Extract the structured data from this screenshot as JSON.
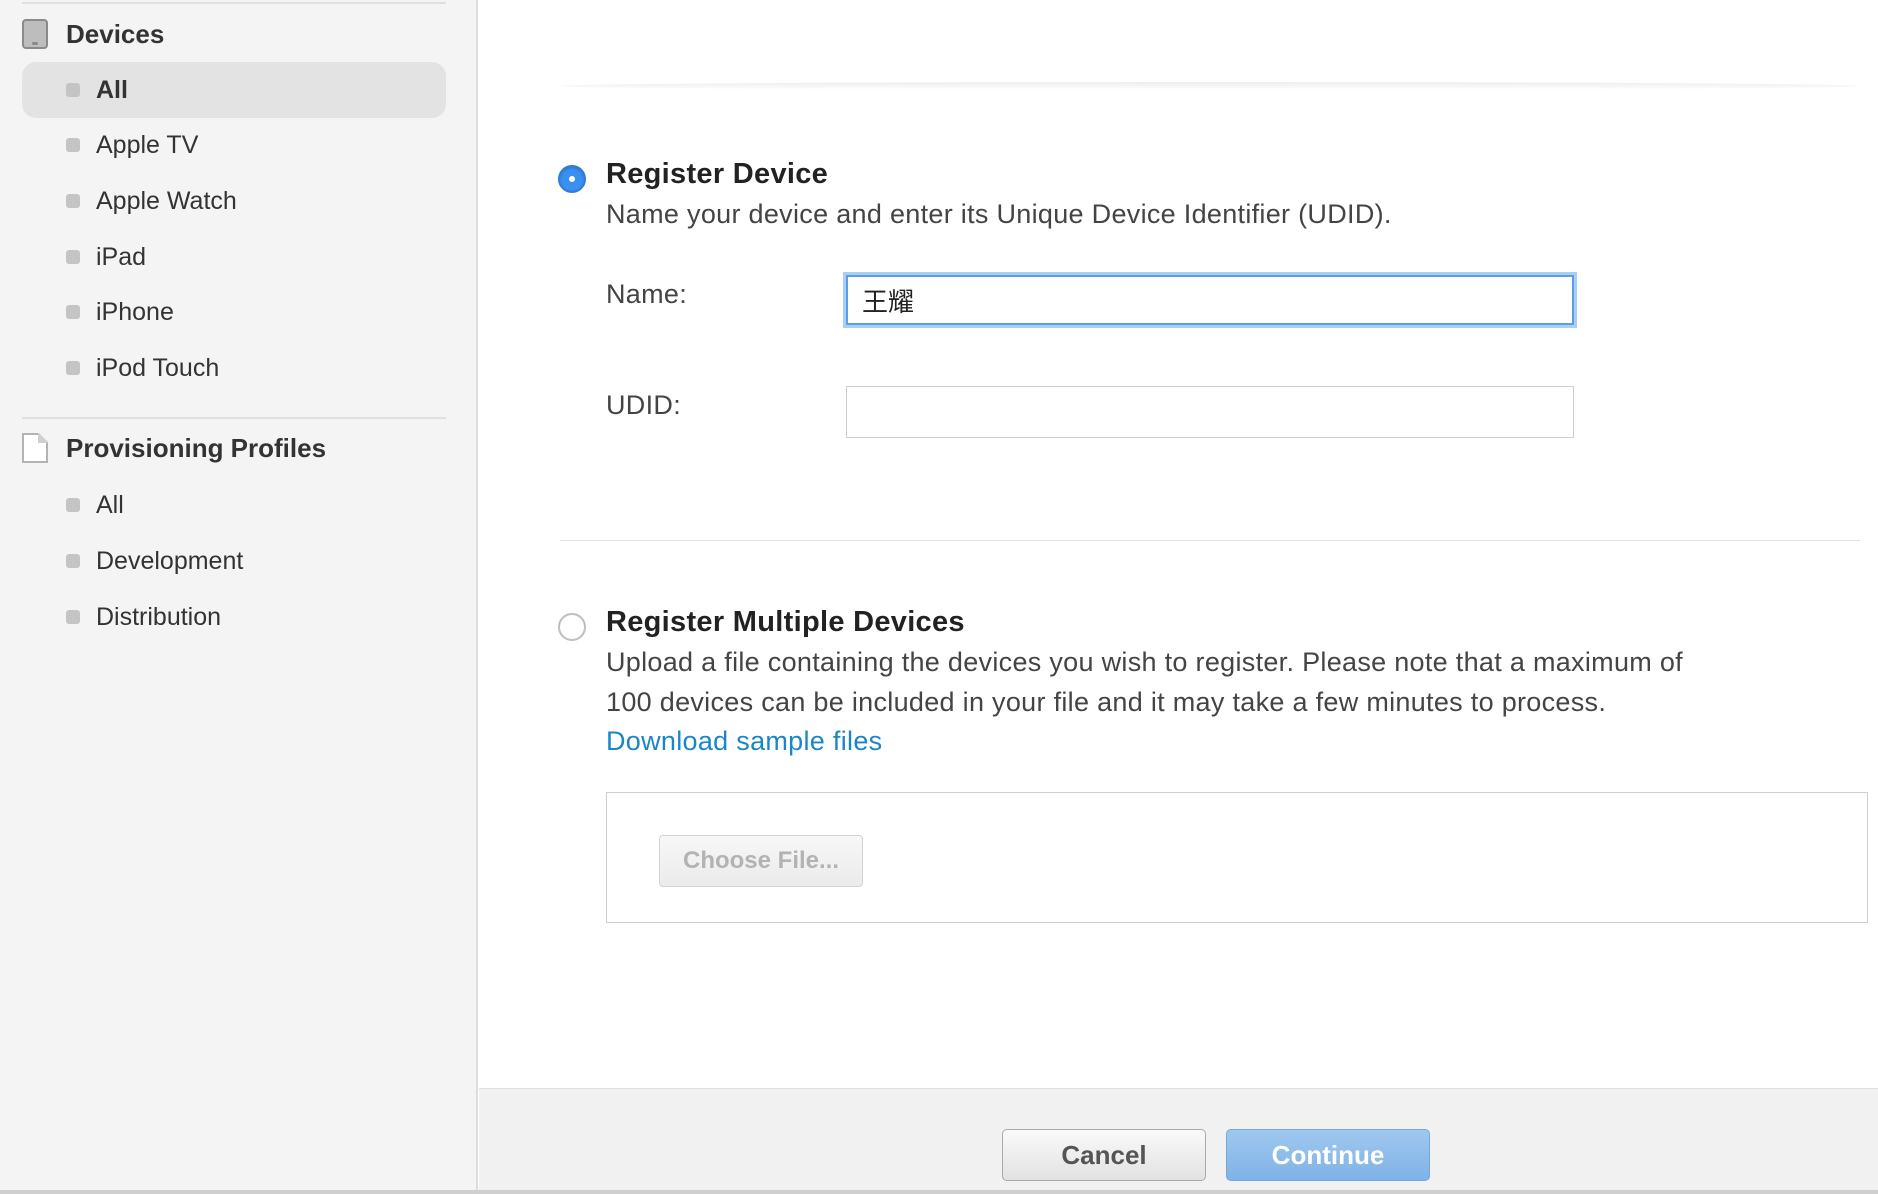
{
  "sidebar": {
    "devices": {
      "heading": "Devices",
      "icon": "device-icon",
      "items": [
        {
          "label": "All",
          "active": true
        },
        {
          "label": "Apple TV"
        },
        {
          "label": "Apple Watch"
        },
        {
          "label": "iPad"
        },
        {
          "label": "iPhone"
        },
        {
          "label": "iPod Touch"
        }
      ]
    },
    "profiles": {
      "heading": "Provisioning Profiles",
      "icon": "document-icon",
      "items": [
        {
          "label": "All"
        },
        {
          "label": "Development"
        },
        {
          "label": "Distribution"
        }
      ]
    }
  },
  "register_single": {
    "selected": true,
    "title": "Register Device",
    "description": "Name your device and enter its Unique Device Identifier (UDID).",
    "name_label": "Name:",
    "name_value": "王耀",
    "udid_label": "UDID:",
    "udid_value": ""
  },
  "register_multiple": {
    "selected": false,
    "title": "Register Multiple Devices",
    "description_line1": "Upload a file containing the devices you wish to register. Please note that a maximum of",
    "description_line2": "100 devices can be included in your file and it may take a few minutes to process.",
    "sample_link": "Download sample files",
    "choose_file_label": "Choose File..."
  },
  "footer": {
    "cancel_label": "Cancel",
    "continue_label": "Continue"
  },
  "colors": {
    "accent": "#3b8ff0",
    "link": "#1a86c8",
    "continue_button": "#8dbdea"
  }
}
